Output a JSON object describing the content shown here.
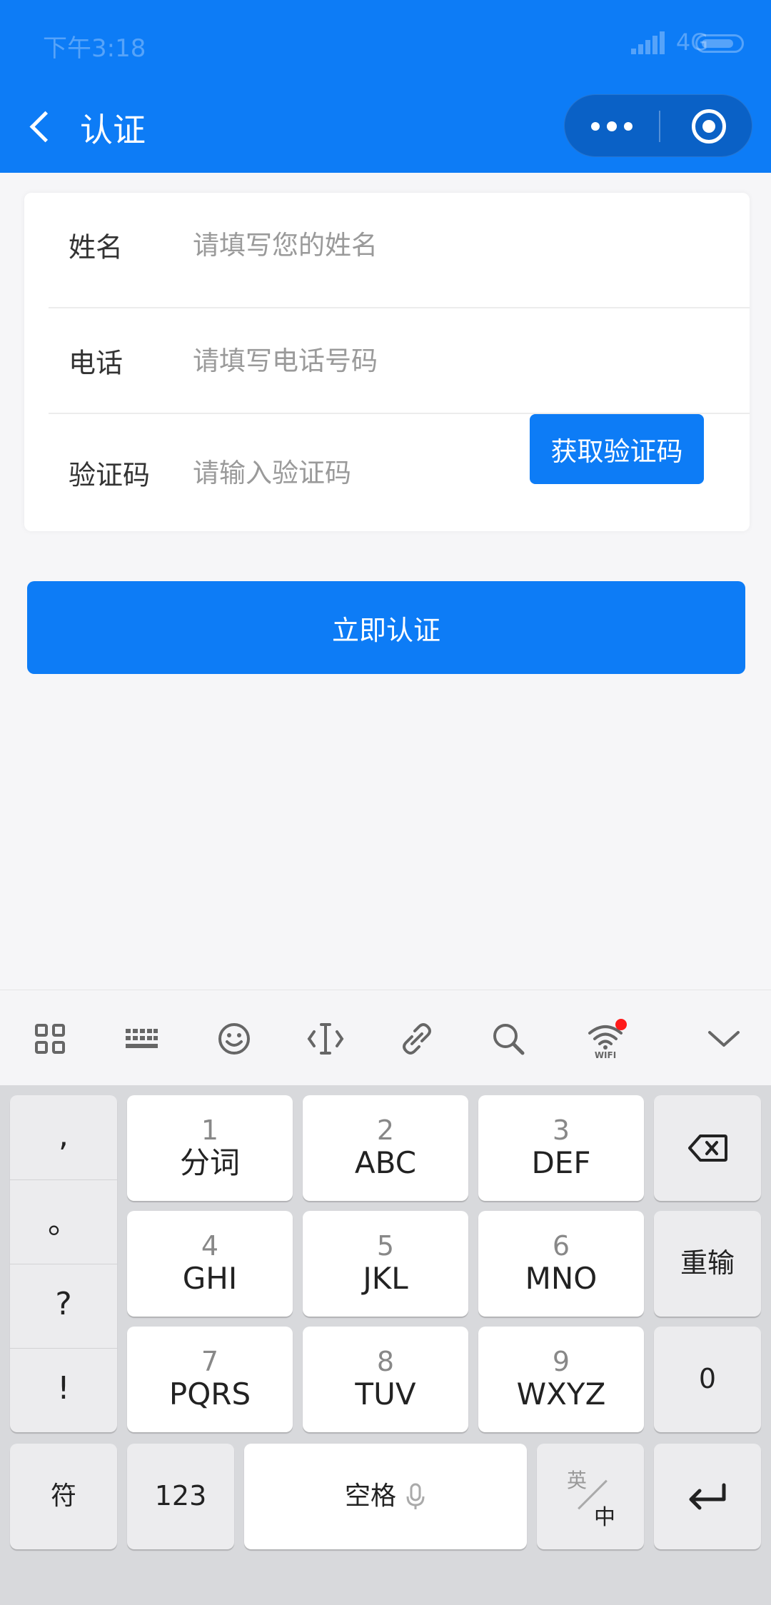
{
  "status": {
    "time": "下午3:18",
    "network": "4G"
  },
  "nav": {
    "title": "认证"
  },
  "form": {
    "name": {
      "label": "姓名",
      "placeholder": "请填写您的姓名"
    },
    "phone": {
      "label": "电话",
      "placeholder": "请填写电话号码"
    },
    "code": {
      "label": "验证码",
      "placeholder": "请输入验证码",
      "button": "获取验证码"
    }
  },
  "submit_label": "立即认证",
  "keyboard": {
    "punct": [
      ",",
      "。",
      "?",
      "!"
    ],
    "keys": [
      {
        "num": "1",
        "letters": "分词"
      },
      {
        "num": "2",
        "letters": "ABC"
      },
      {
        "num": "3",
        "letters": "DEF"
      },
      {
        "num": "4",
        "letters": "GHI"
      },
      {
        "num": "5",
        "letters": "JKL"
      },
      {
        "num": "6",
        "letters": "MNO"
      },
      {
        "num": "7",
        "letters": "PQRS"
      },
      {
        "num": "8",
        "letters": "TUV"
      },
      {
        "num": "9",
        "letters": "WXYZ"
      }
    ],
    "retype": "重输",
    "zero": "0",
    "symbols": "符",
    "numbers": "123",
    "space": "空格",
    "lang_en": "英",
    "lang_zh": "中"
  },
  "colors": {
    "primary": "#0d7cf6",
    "capsule": "#0a61c6",
    "notify_dot": "#ff1a1a"
  }
}
